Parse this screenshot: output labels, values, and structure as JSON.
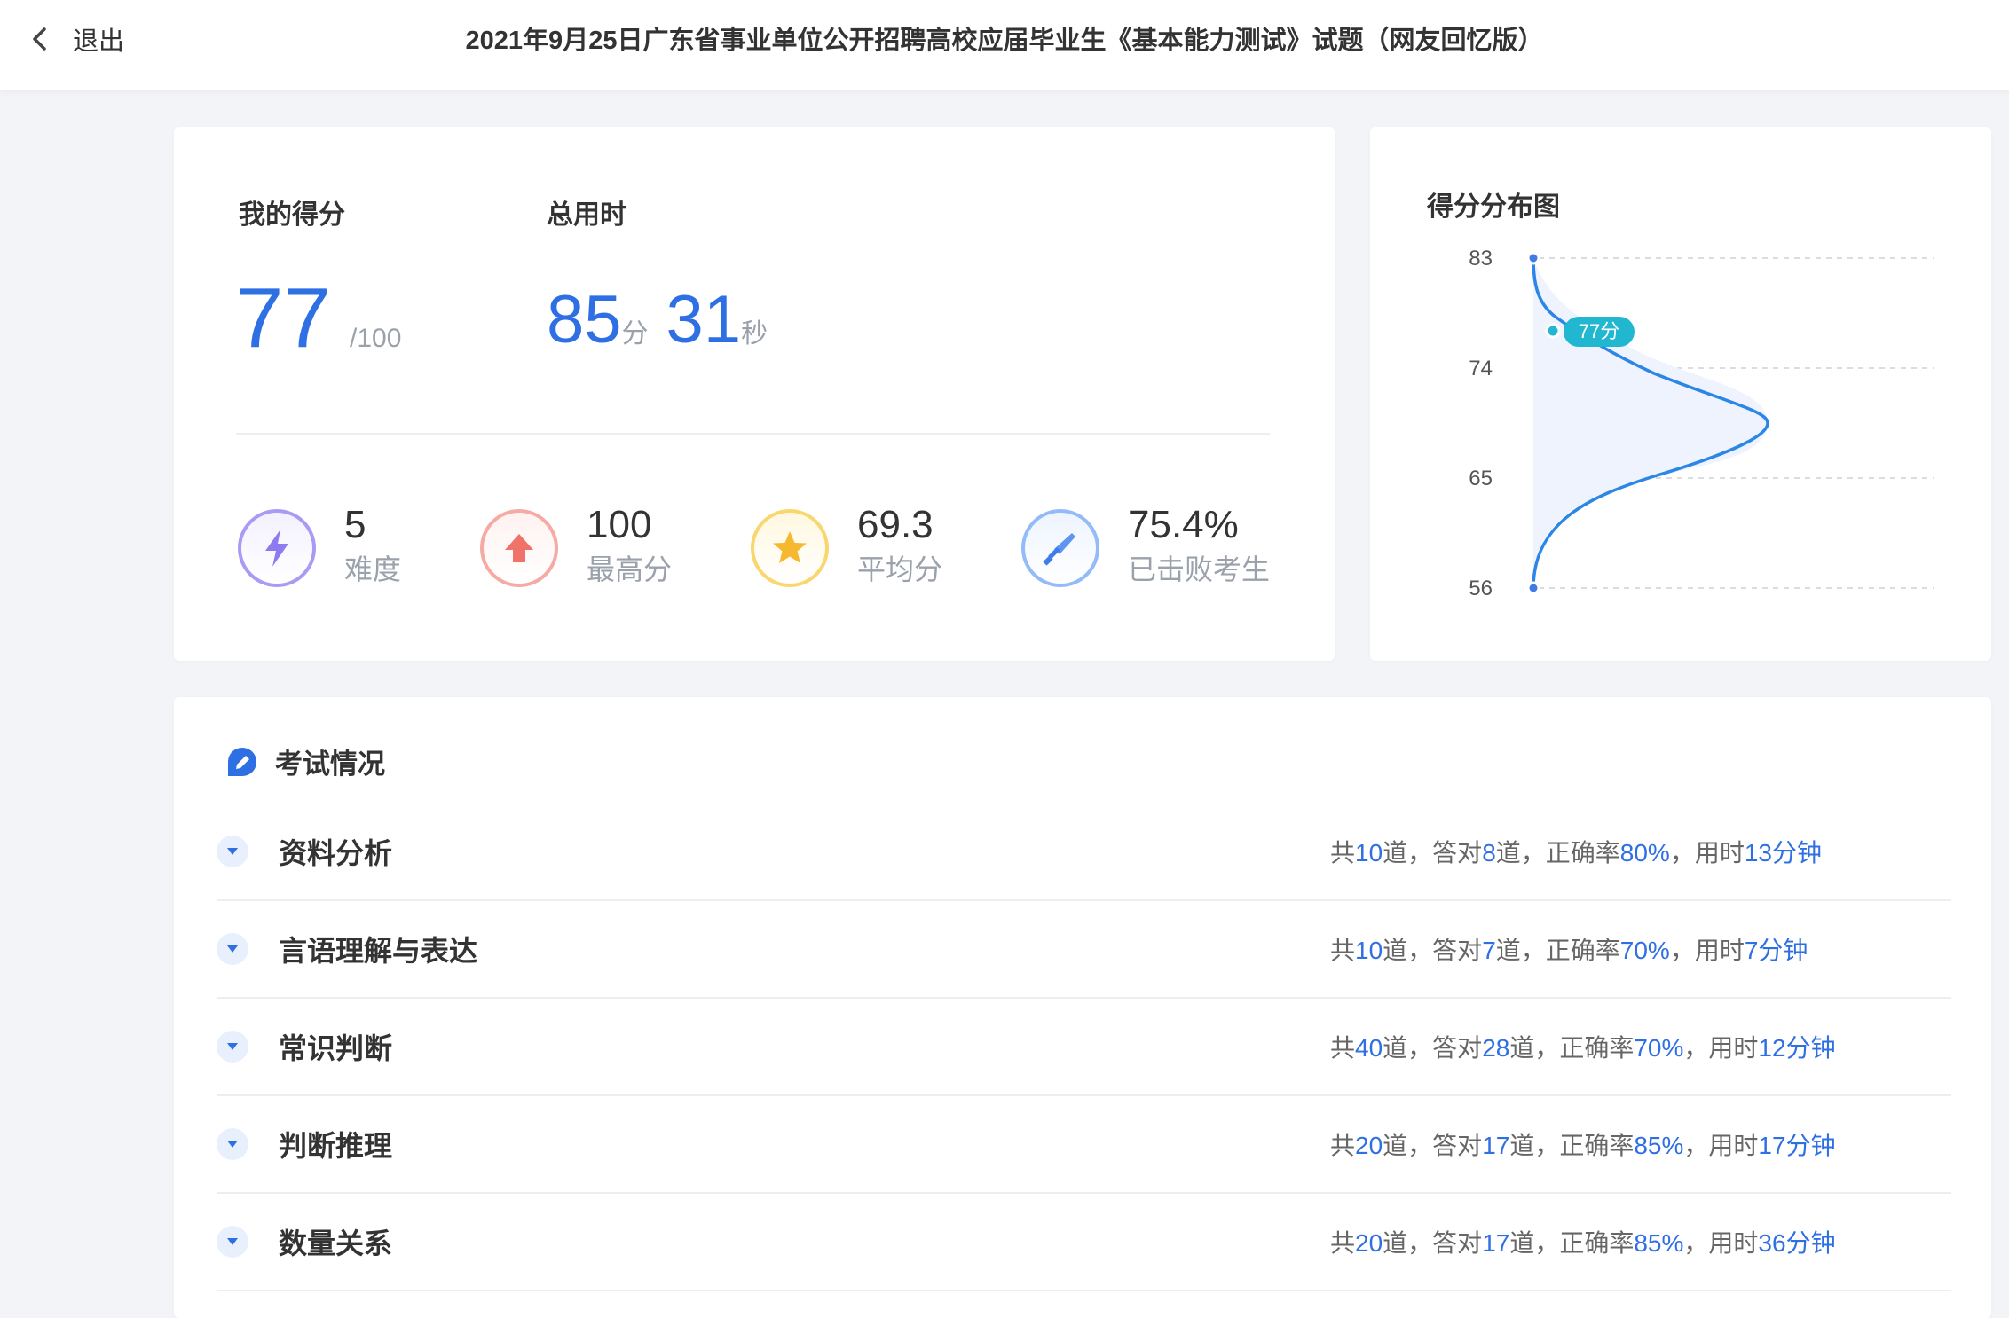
{
  "header": {
    "back_label": "退出",
    "title": "2021年9月25日广东省事业单位公开招聘高校应届毕业生《基本能力测试》试题（网友回忆版）"
  },
  "score_card": {
    "my_score_label": "我的得分",
    "score": "77",
    "score_max": "/100",
    "time_label": "总用时",
    "minutes": "85",
    "minutes_unit": "分",
    "seconds": "31",
    "seconds_unit": "秒",
    "stats": [
      {
        "value": "5",
        "label": "难度",
        "icon": "lightning-icon",
        "color": "#8e7bef"
      },
      {
        "value": "100",
        "label": "最高分",
        "icon": "arrow-up-icon",
        "color": "#f28b82"
      },
      {
        "value": "69.3",
        "label": "平均分",
        "icon": "star-icon",
        "color": "#f7c948"
      },
      {
        "value": "75.4%",
        "label": "已击败考生",
        "icon": "sword-icon",
        "color": "#6fa3f7"
      }
    ]
  },
  "distribution": {
    "title": "得分分布图",
    "my_score_tag": "77分"
  },
  "chart_data": {
    "type": "line",
    "title": "得分分布图",
    "y_ticks": [
      83,
      74,
      65,
      56
    ],
    "ylim": [
      56,
      83
    ],
    "marked_value": 77,
    "grid": true
  },
  "exam": {
    "title": "考试情况",
    "sections": [
      {
        "name": "资料分析",
        "t1": "共",
        "total": "10",
        "t2": "道，答对",
        "correct": "8",
        "t3": "道，正确率",
        "rate": "80%",
        "t4": "，用时",
        "time": "13分钟"
      },
      {
        "name": "言语理解与表达",
        "t1": "共",
        "total": "10",
        "t2": "道，答对",
        "correct": "7",
        "t3": "道，正确率",
        "rate": "70%",
        "t4": "，用时",
        "time": "7分钟"
      },
      {
        "name": "常识判断",
        "t1": "共",
        "total": "40",
        "t2": "道，答对",
        "correct": "28",
        "t3": "道，正确率",
        "rate": "70%",
        "t4": "，用时",
        "time": "12分钟"
      },
      {
        "name": "判断推理",
        "t1": "共",
        "total": "20",
        "t2": "道，答对",
        "correct": "17",
        "t3": "道，正确率",
        "rate": "85%",
        "t4": "，用时",
        "time": "17分钟"
      },
      {
        "name": "数量关系",
        "t1": "共",
        "total": "20",
        "t2": "道，答对",
        "correct": "17",
        "t3": "道，正确率",
        "rate": "85%",
        "t4": "，用时",
        "time": "36分钟"
      }
    ]
  },
  "colors": {
    "accent": "#2f6fe4",
    "curve": "#2b86e6",
    "tag": "#22b7d1"
  }
}
